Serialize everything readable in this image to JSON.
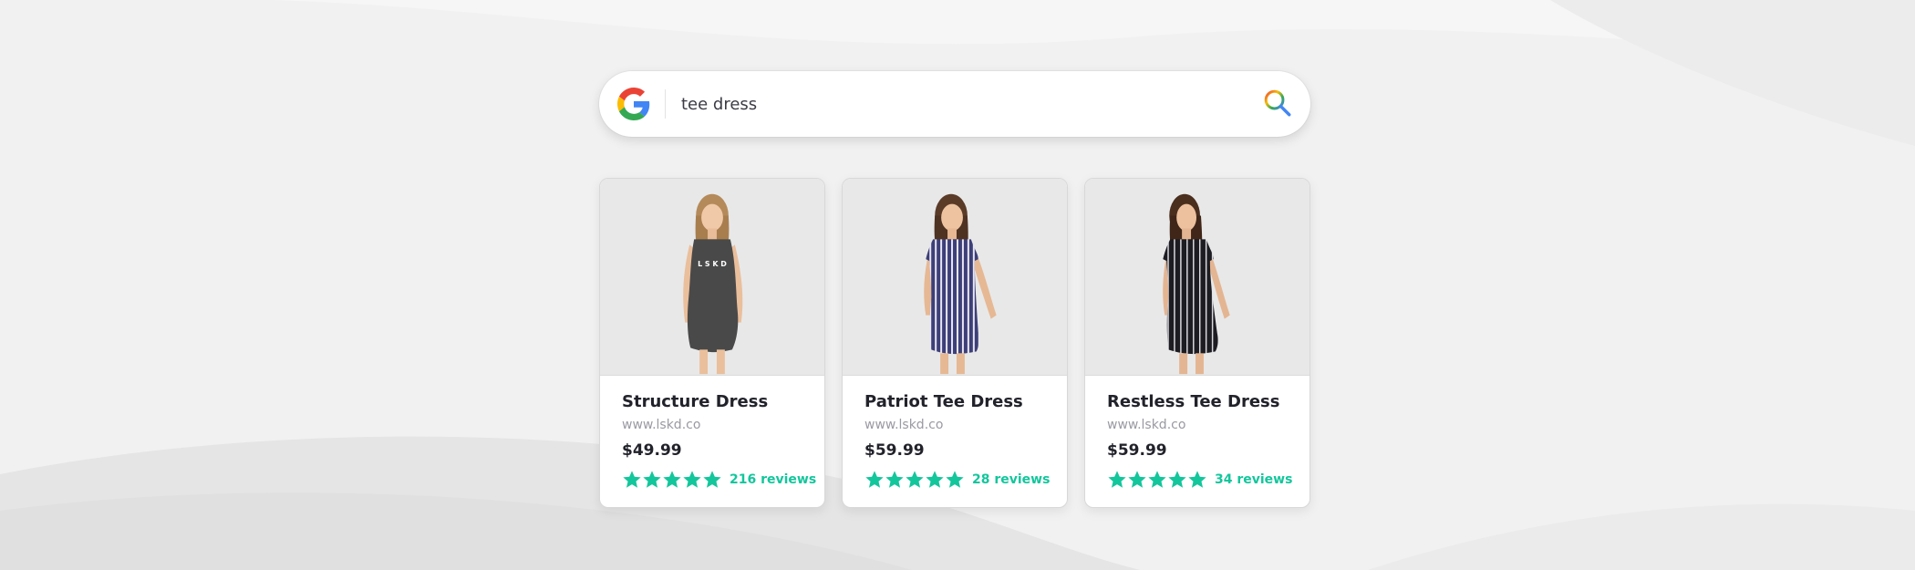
{
  "search": {
    "query": "tee dress",
    "engine_icon": "google-g-icon",
    "button_icon": "search-icon"
  },
  "colors": {
    "accent": "#13c69c",
    "title": "#22222b",
    "url": "#9a9aa2",
    "background": "#f1f1f1"
  },
  "products": [
    {
      "title": "Structure Dress",
      "url": "www.lskd.co",
      "price": "$49.99",
      "rating": 5,
      "reviews": "216 reviews",
      "dress_color": "#4a4949",
      "print": "L S K D"
    },
    {
      "title": "Patriot Tee Dress",
      "url": "www.lskd.co",
      "price": "$59.99",
      "rating": 5,
      "reviews": "28 reviews",
      "dress_color": "#3d3f78"
    },
    {
      "title": "Restless Tee Dress",
      "url": "www.lskd.co",
      "price": "$59.99",
      "rating": 5,
      "reviews": "34 reviews",
      "dress_color": "#1c1c22"
    }
  ]
}
